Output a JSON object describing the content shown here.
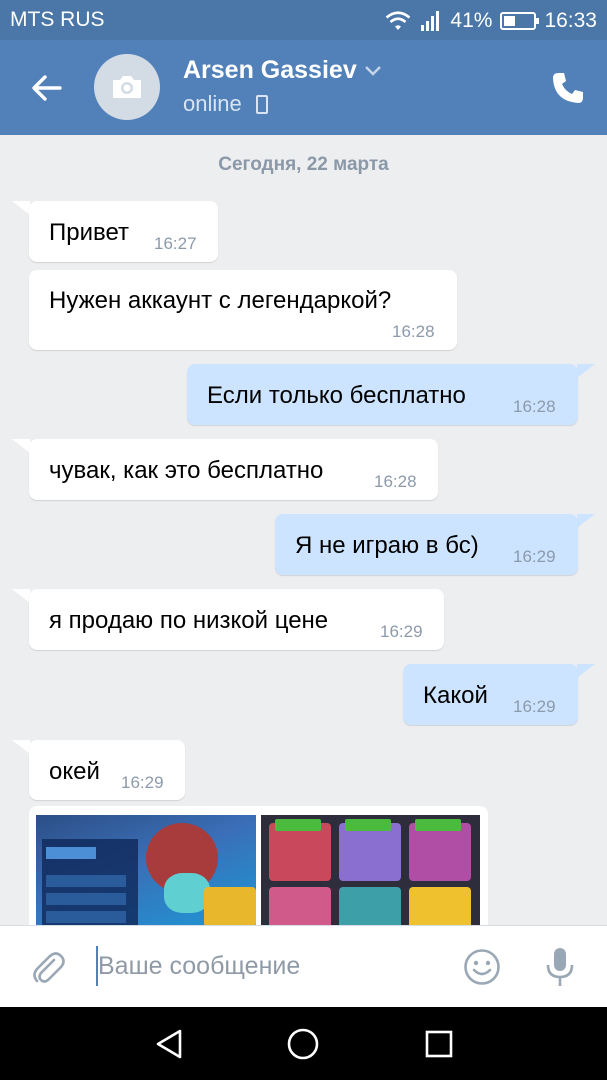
{
  "status_bar": {
    "carrier": "MTS RUS",
    "battery_percent": "41%",
    "battery_level": 0.41,
    "time": "16:33"
  },
  "header": {
    "contact_name": "Arsen Gassiev",
    "status": "online",
    "icons": [
      "back-arrow-icon",
      "camera-icon",
      "chevron-down-icon",
      "mobile-phone-icon",
      "phone-call-icon"
    ]
  },
  "chat": {
    "date_separator": "Сегодня, 22 марта",
    "messages": [
      {
        "direction": "in",
        "text": "Привет",
        "time": "16:27"
      },
      {
        "direction": "in",
        "text": "Нужен аккаунт с легендаркой?",
        "time": "16:28"
      },
      {
        "direction": "out",
        "text": "Если только бесплатно",
        "time": "16:28"
      },
      {
        "direction": "in",
        "text": "чувак, как это бесплатно",
        "time": "16:28"
      },
      {
        "direction": "out",
        "text": "Я не играю в бс)",
        "time": "16:29"
      },
      {
        "direction": "in",
        "text": "я продаю по низкой цене",
        "time": "16:29"
      },
      {
        "direction": "out",
        "text": "Какой",
        "time": "16:29"
      },
      {
        "direction": "in",
        "text": "окей",
        "time": "16:29"
      }
    ],
    "attachment": {
      "type": "photos",
      "count": 2
    }
  },
  "composer": {
    "placeholder": "Ваше сообщение",
    "value": "",
    "icons": [
      "paperclip-icon",
      "emoji-icon",
      "microphone-icon"
    ]
  },
  "nav_bar": {
    "icons": [
      "nav-back-icon",
      "nav-home-icon",
      "nav-recents-icon"
    ]
  },
  "colors": {
    "header_bg": "#5181b8",
    "status_bar_bg": "#4a76a8",
    "chat_bg": "#edeef0",
    "incoming_bubble": "#ffffff",
    "outgoing_bubble": "#cce4ff",
    "time_text": "#8c9aab",
    "accent": "#5181b8"
  }
}
